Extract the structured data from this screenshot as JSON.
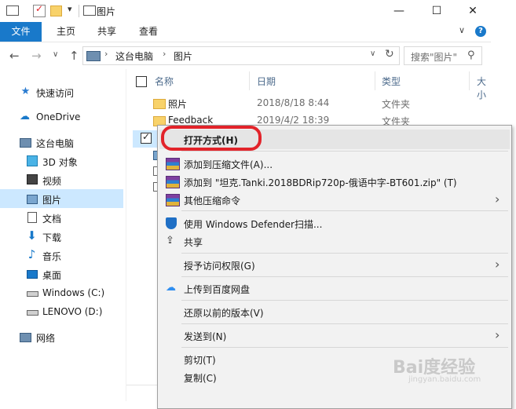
{
  "window": {
    "title": "图片",
    "minimize_glyph": "—",
    "maximize_glyph": "☐",
    "close_glyph": "✕",
    "qa_dropdown_glyph": "▾"
  },
  "ribbon": {
    "tabs": [
      "文件",
      "主页",
      "共享",
      "查看"
    ],
    "help_glyph": "?",
    "collapse_glyph": "∨"
  },
  "nav": {
    "back_glyph": "←",
    "forward_glyph": "→",
    "history_glyph": "∨",
    "up_glyph": "↑",
    "breadcrumb": [
      "这台电脑",
      "图片"
    ],
    "breadcrumb_sep": "›",
    "dropdown_glyph": "∨",
    "refresh_glyph": "↻",
    "search_placeholder": "搜索\"图片\"",
    "search_glyph": "⚲"
  },
  "sidebar": {
    "items": [
      {
        "label": "快速访问",
        "icon": "star-icon"
      },
      {
        "label": "OneDrive",
        "icon": "cloud-icon"
      },
      {
        "label": "这台电脑",
        "icon": "computer-icon"
      },
      {
        "label": "3D 对象",
        "icon": "cube-icon"
      },
      {
        "label": "视频",
        "icon": "video-icon"
      },
      {
        "label": "图片",
        "icon": "pictures-icon"
      },
      {
        "label": "文档",
        "icon": "document-icon"
      },
      {
        "label": "下载",
        "icon": "download-icon"
      },
      {
        "label": "音乐",
        "icon": "music-icon"
      },
      {
        "label": "桌面",
        "icon": "desktop-icon"
      },
      {
        "label": "Windows (C:)",
        "icon": "drive-icon"
      },
      {
        "label": "LENOVO (D:)",
        "icon": "drive-icon"
      },
      {
        "label": "网络",
        "icon": "network-icon"
      }
    ]
  },
  "filelist": {
    "columns": [
      "名称",
      "日期",
      "类型",
      "大小"
    ],
    "rows": [
      {
        "name": "照片",
        "date": "2018/8/18 8:44",
        "type": "文件夹"
      },
      {
        "name": "Feedback",
        "date": "2019/4/2 18:39",
        "type": "文件夹"
      }
    ],
    "check_glyph": "✓"
  },
  "context_menu": {
    "items": [
      {
        "label": "打开方式(H)",
        "icon": "",
        "bold": true
      },
      {
        "label": "添加到压缩文件(A)...",
        "icon": "winrar-icon"
      },
      {
        "label": "添加到 \"坦克.Tanki.2018BDRip720p-俄语中字-BT601.zip\" (T)",
        "icon": "winrar-icon"
      },
      {
        "label": "其他压缩命令",
        "icon": "winrar-icon",
        "submenu": true
      },
      {
        "label": "使用 Windows Defender扫描...",
        "icon": "defender-icon"
      },
      {
        "label": "共享",
        "icon": "share-icon"
      },
      {
        "label": "授予访问权限(G)",
        "icon": "",
        "submenu": true
      },
      {
        "label": "上传到百度网盘",
        "icon": "baidu-netdisk-icon"
      },
      {
        "label": "还原以前的版本(V)",
        "icon": ""
      },
      {
        "label": "发送到(N)",
        "icon": "",
        "submenu": true
      },
      {
        "label": "剪切(T)",
        "icon": ""
      },
      {
        "label": "复制(C)",
        "icon": ""
      }
    ],
    "submenu_glyph": "›",
    "highlight_color": "#e2232a"
  },
  "watermark": {
    "brand": "Bai度经验",
    "sub": "jingyan.baidu.com"
  },
  "colors": {
    "accent": "#1979ca",
    "selection": "#cce8ff",
    "menu_bg": "#f2f2f2"
  }
}
